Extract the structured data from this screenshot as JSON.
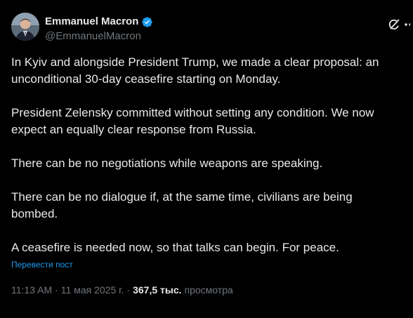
{
  "author": {
    "display_name": "Emmanuel Macron",
    "handle": "@EmmanuelMacron",
    "verified_color": "#1d9bf0"
  },
  "icons": {
    "grok": "grok-icon",
    "more": "more-icon",
    "verified": "verified-badge-icon"
  },
  "post": {
    "paragraphs": [
      "In Kyiv and alongside President Trump, we made a clear proposal: an unconditional 30-day ceasefire starting on Monday.",
      "President Zelensky committed without setting any condition. We now expect an equally clear response from Russia.",
      "There can be no negotiations while weapons are speaking.",
      "There can be no dialogue if, at the same time, civilians are being bombed.",
      "A ceasefire is needed now, so that talks can begin. For peace."
    ],
    "translate_label": "Перевести пост"
  },
  "meta": {
    "time": "11:13 AM",
    "separator": "·",
    "date": "11 мая 2025 г.",
    "views_count": "367,5 тыс.",
    "views_label": "просмотра"
  }
}
